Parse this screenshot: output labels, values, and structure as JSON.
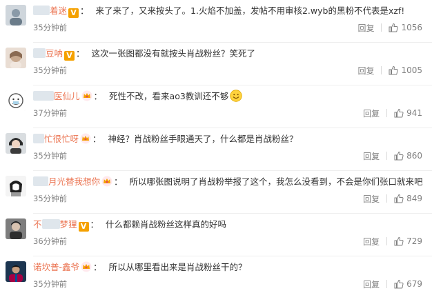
{
  "comments": [
    {
      "username_visible": "着迷",
      "badge": "v",
      "text": "来了来了，又来按头了。1.火焰不加盖，发帖不用审核2.wyb的黑粉不代表是xzf!",
      "time": "35分钟前",
      "reply": "回复",
      "likes": "1056"
    },
    {
      "username_visible": "豆呐",
      "badge": "v",
      "text": "这次一张图都没有就按头肖战粉丝？笑死了",
      "time": "35分钟前",
      "reply": "回复",
      "likes": "1005"
    },
    {
      "username_visible": "医仙儿",
      "badge": "crown",
      "text": "死性不改，看来ao3教训还不够",
      "emoji": "smile-emoji",
      "time": "37分钟前",
      "reply": "回复",
      "likes": "941"
    },
    {
      "username_visible": "忙很忙呀",
      "badge": "crown",
      "text": "神经？肖战粉丝手眼通天了，什么都是肖战粉丝？",
      "time": "35分钟前",
      "reply": "回复",
      "likes": "860"
    },
    {
      "username_visible": "月光替我想你",
      "badge": "crown",
      "text": "所以哪张图说明了肖战粉举报了这个，我怎么没看到，不会是你们张口就来吧",
      "time": "35分钟前",
      "reply": "回复",
      "likes": "849"
    },
    {
      "username_visible": "梦狸",
      "username_prefix": "不",
      "badge": "v",
      "text": "什么都赖肖战粉丝这样真的好吗",
      "time": "36分钟前",
      "reply": "回复",
      "likes": "729"
    },
    {
      "username_visible": "诺坎普-鑫爷",
      "badge": "crown",
      "text": "所以从哪里看出来是肖战粉丝干的？",
      "time": "35分钟前",
      "reply": "回复",
      "likes": "679"
    }
  ],
  "colors": {
    "username": "#eb7350",
    "meta": "#808080",
    "text": "#333333",
    "vip_badge": "#f5a100"
  }
}
